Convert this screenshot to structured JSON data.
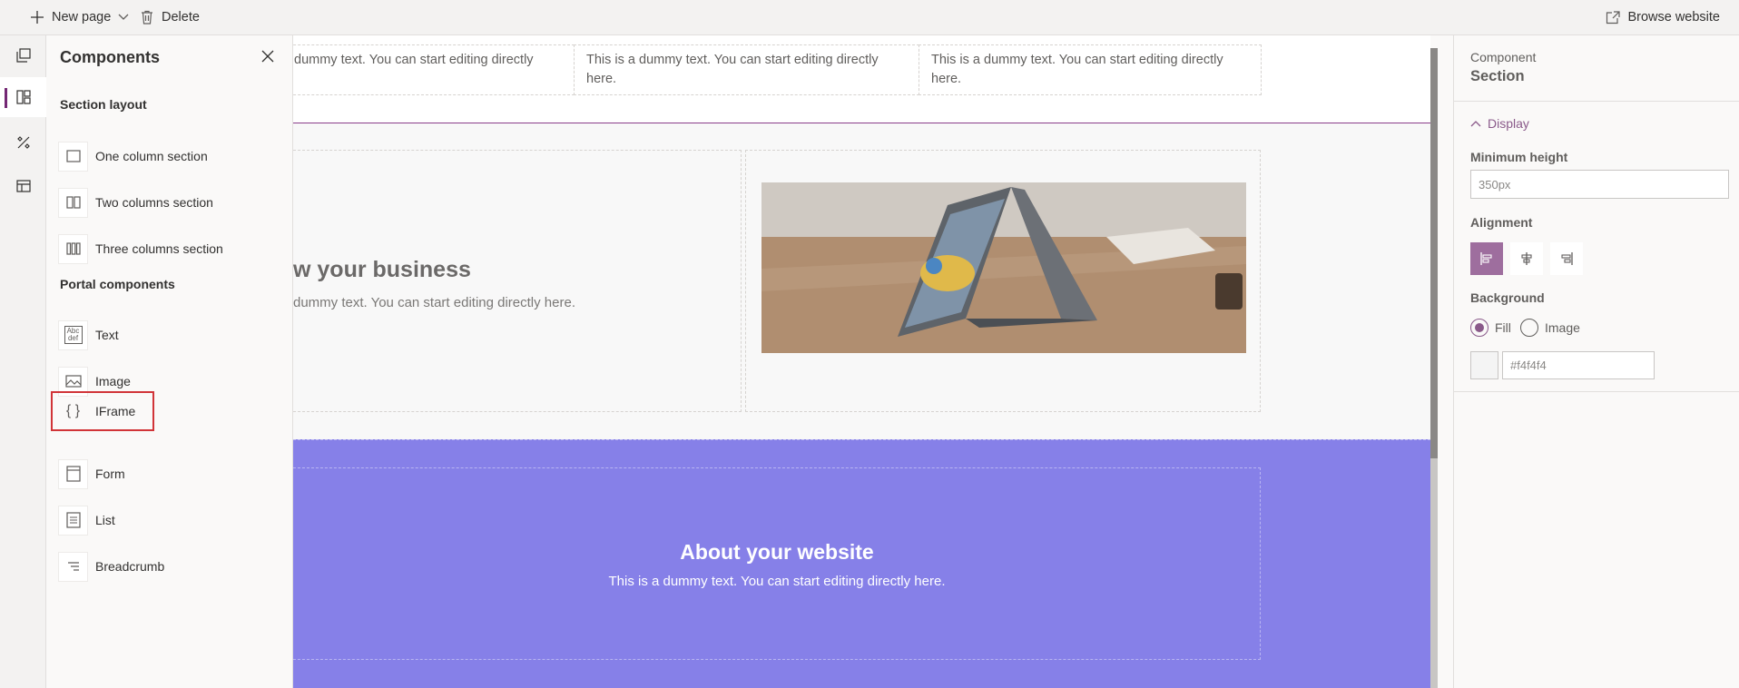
{
  "toolbar": {
    "new_page": "New page",
    "delete": "Delete",
    "browse_website": "Browse website"
  },
  "rail": {
    "items": [
      "pages-icon",
      "components-icon",
      "themes-icon",
      "data-icon"
    ],
    "active": "components-icon"
  },
  "components_panel": {
    "title": "Components",
    "section_layout_heading": "Section layout",
    "section_layout": [
      {
        "label": "One column section",
        "icon": "one-column-icon"
      },
      {
        "label": "Two columns section",
        "icon": "two-columns-icon"
      },
      {
        "label": "Three columns section",
        "icon": "three-columns-icon"
      }
    ],
    "portal_components_heading": "Portal components",
    "portal_components": [
      {
        "label": "Text",
        "icon": "text-icon",
        "glyph": "Abc def"
      },
      {
        "label": "Image",
        "icon": "image-icon"
      },
      {
        "label": "IFrame",
        "icon": "iframe-icon",
        "glyph": "{ }",
        "selected": true
      },
      {
        "label": "Form",
        "icon": "form-icon"
      },
      {
        "label": "List",
        "icon": "list-icon"
      },
      {
        "label": "Breadcrumb",
        "icon": "breadcrumb-icon"
      }
    ]
  },
  "canvas": {
    "top_cells": [
      "dummy text. You can start editing directly",
      "This is a dummy text. You can start editing directly here.",
      "This is a dummy text. You can start editing directly here."
    ],
    "grow": {
      "title": "w your business",
      "text": "dummy text. You can start editing directly here."
    },
    "about": {
      "title": "About your website",
      "text": "This is a dummy text. You can start editing directly here.",
      "background": "#8680e8"
    }
  },
  "properties": {
    "caption": "Component",
    "title": "Section",
    "display_toggle": "Display",
    "min_height_label": "Minimum height",
    "min_height_value": "350px",
    "alignment_label": "Alignment",
    "alignment_selected": "left",
    "background_label": "Background",
    "fill_label": "Fill",
    "image_label": "Image",
    "background_mode": "Fill",
    "color_value": "#f4f4f4"
  },
  "colors": {
    "accent": "#742774",
    "selected_outline": "#d13438"
  }
}
